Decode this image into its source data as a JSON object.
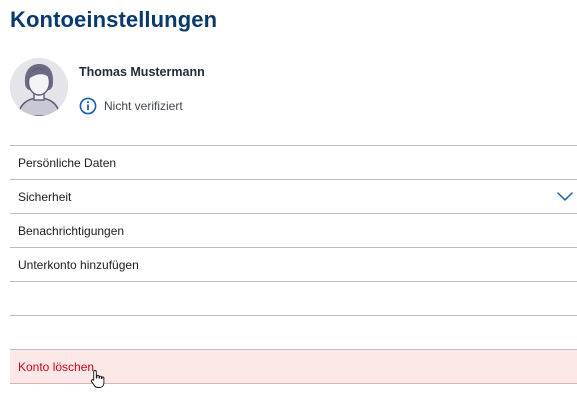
{
  "page": {
    "title": "Kontoeinstellungen"
  },
  "profile": {
    "name": "Thomas Mustermann",
    "verification_status": "Nicht verifiziert",
    "icons": {
      "avatar": "user-avatar-placeholder",
      "verification": "info-icon"
    }
  },
  "settings": {
    "items": [
      {
        "label": "Persönliche Daten"
      },
      {
        "label": "Sicherheit",
        "icon": "chevron-down-icon"
      },
      {
        "label": "Benachrichtigungen"
      },
      {
        "label": "Unterkonto hinzufügen"
      },
      {
        "label": ""
      },
      {
        "label": ""
      },
      {
        "label": "Konto löschen",
        "style": "danger"
      }
    ]
  },
  "colors": {
    "title": "#0a3a6b",
    "accent": "#1a5ea8",
    "danger_text": "#d0021b",
    "danger_background": "#fde8e8",
    "divider": "#b9bdc2"
  }
}
